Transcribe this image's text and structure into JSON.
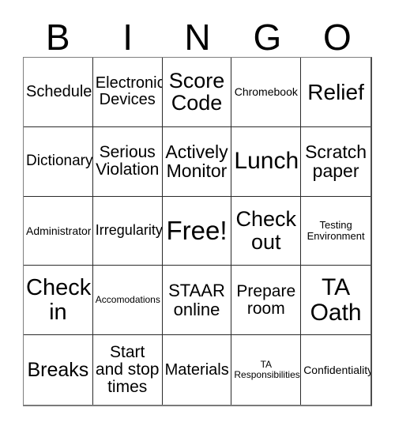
{
  "card": {
    "title": "BINGO",
    "header_letters": [
      "B",
      "I",
      "N",
      "G",
      "O"
    ],
    "columns": 5,
    "rows": 5,
    "free_space_index": 12,
    "colors": {
      "background": "#ffffff",
      "text": "#000000",
      "grid_line": "#2b2b2b",
      "outer_border": "#7f7f7f"
    },
    "cells": [
      {
        "text": "Schedule",
        "size": "fs-20",
        "lines": 1
      },
      {
        "text": "Electronic\nDevices",
        "size": "fs-20",
        "lines": 2
      },
      {
        "text": "Score\nCode",
        "size": "fs-27",
        "lines": 2
      },
      {
        "text": "Chromebook",
        "size": "fs-14",
        "lines": 1
      },
      {
        "text": "Relief",
        "size": "fs-28",
        "lines": 1
      },
      {
        "text": "Dictionary",
        "size": "fs-19",
        "lines": 1
      },
      {
        "text": "Serious\nViolation",
        "size": "fs-21",
        "lines": 2
      },
      {
        "text": "Actively\nMonitor",
        "size": "fs-23",
        "lines": 2
      },
      {
        "text": "Lunch",
        "size": "fs-30",
        "lines": 1
      },
      {
        "text": "Scratch\npaper",
        "size": "fs-23",
        "lines": 2
      },
      {
        "text": "Administrator",
        "size": "fs-14",
        "lines": 1
      },
      {
        "text": "Irregularity",
        "size": "fs-18",
        "lines": 1
      },
      {
        "text": "Free!",
        "size": "fs-33",
        "lines": 1
      },
      {
        "text": "Check\nout",
        "size": "fs-27",
        "lines": 2
      },
      {
        "text": "Testing\nEnvironment",
        "size": "fs-13",
        "lines": 2
      },
      {
        "text": "Check\nin",
        "size": "fs-29",
        "lines": 2
      },
      {
        "text": "Accomodations",
        "size": "fs-12",
        "lines": 1
      },
      {
        "text": "STAAR\nonline",
        "size": "fs-22",
        "lines": 2
      },
      {
        "text": "Prepare\nroom",
        "size": "fs-21",
        "lines": 2
      },
      {
        "text": "TA\nOath",
        "size": "fs-30",
        "lines": 2
      },
      {
        "text": "Breaks",
        "size": "fs-25",
        "lines": 1
      },
      {
        "text": "Start\nand stop\ntimes",
        "size": "fs-21",
        "lines": 3
      },
      {
        "text": "Materials",
        "size": "fs-20",
        "lines": 1
      },
      {
        "text": "TA\nResponsibilities",
        "size": "fs-12",
        "lines": 2
      },
      {
        "text": "Confidentiality",
        "size": "fs-14",
        "lines": 1
      }
    ]
  }
}
